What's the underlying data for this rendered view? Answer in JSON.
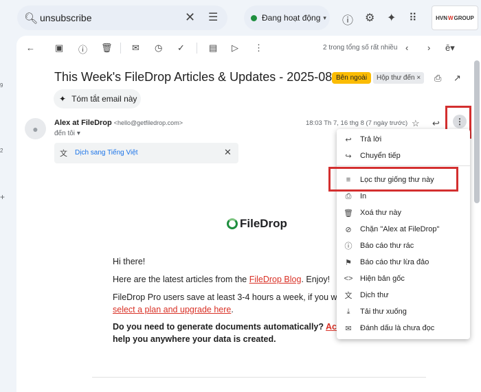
{
  "search": {
    "value": "unsubscribe"
  },
  "status": {
    "label": "Đang hoạt động"
  },
  "brand": {
    "left": "HVN",
    "right": "GROUP"
  },
  "toolbar": {
    "paging": "2 trong tổng số rất nhiều"
  },
  "email": {
    "subject": "This Week's FileDrop Articles & Updates - 2025-08-16",
    "label_external": "Bên ngoài",
    "label_inbox": "Hộp thư đến",
    "summary_button": "Tóm tắt email này",
    "sender_name": "Alex at FileDrop",
    "sender_email": "<hello@getfiledrop.com>",
    "to": "đến tôi",
    "datetime": "18:03 Th 7, 16 thg 8 (7 ngày trước)",
    "translate_link": "Dịch sang Tiếng Việt"
  },
  "body": {
    "logo": "FileDrop",
    "greeting": "Hi there!",
    "line1_pre": "Here are the latest articles from the ",
    "line1_link": "FileDrop Blog",
    "line1_post": ". Enjoy!",
    "line2": "FileDrop Pro users save at least 3-4 hours a week, if you war",
    "line2_link": "select a plan and upgrade here",
    "line2_post": ".",
    "line3": "Do you need to generate documents automatically? ",
    "line3_link": "Activ",
    "line4": "help you anywhere your data is created."
  },
  "menu": {
    "items": [
      {
        "label": "Trả lời",
        "icon": "reply-icon"
      },
      {
        "label": "Chuyển tiếp",
        "icon": "forward-icon"
      },
      {
        "label": "Lọc thư giống thư này",
        "icon": "filter-icon"
      },
      {
        "label": "In",
        "icon": "print-icon"
      },
      {
        "label": "Xoá thư này",
        "icon": "trash-icon"
      },
      {
        "label": "Chặn \"Alex at FileDrop\"",
        "icon": "block-icon"
      },
      {
        "label": "Báo cáo thư rác",
        "icon": "report-spam-icon"
      },
      {
        "label": "Báo cáo thư lừa đảo",
        "icon": "phishing-icon"
      },
      {
        "label": "Hiện bản gốc",
        "icon": "code-icon"
      },
      {
        "label": "Dịch thư",
        "icon": "translate-icon"
      },
      {
        "label": "Tải thư xuống",
        "icon": "download-icon"
      },
      {
        "label": "Đánh dấu là chưa đọc",
        "icon": "mark-unread-icon"
      }
    ]
  },
  "edge": {
    "a": "9",
    "b": "2",
    "c": "+"
  }
}
